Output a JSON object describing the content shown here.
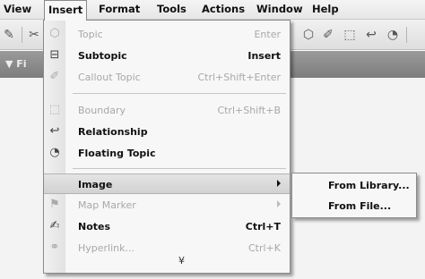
{
  "menubar": {
    "items": [
      "View",
      "Insert",
      "Format",
      "Tools",
      "Actions",
      "Window",
      "Help"
    ]
  },
  "darkbar": {
    "label": "Fi"
  },
  "insert_menu": {
    "items": [
      {
        "label": "Topic",
        "shortcut": "Enter",
        "enabled": false,
        "icon": "topic-icon"
      },
      {
        "label": "Subtopic",
        "shortcut": "Insert",
        "enabled": true,
        "icon": "subtopic-icon"
      },
      {
        "label": "Callout Topic",
        "shortcut": "Ctrl+Shift+Enter",
        "enabled": false,
        "icon": "callout-topic-icon"
      },
      {
        "label": "Boundary",
        "shortcut": "Ctrl+Shift+B",
        "enabled": false,
        "icon": "boundary-icon"
      },
      {
        "label": "Relationship",
        "shortcut": "",
        "enabled": true,
        "icon": "relationship-icon"
      },
      {
        "label": "Floating Topic",
        "shortcut": "",
        "enabled": true,
        "icon": "floating-topic-icon"
      },
      {
        "label": "Image",
        "shortcut": "",
        "enabled": true,
        "icon": "",
        "submenu": true,
        "highlighted": true
      },
      {
        "label": "Map Marker",
        "shortcut": "",
        "enabled": false,
        "icon": "map-marker-icon",
        "submenu": true
      },
      {
        "label": "Notes",
        "shortcut": "Ctrl+T",
        "enabled": true,
        "icon": "notes-icon"
      },
      {
        "label": "Hyperlink...",
        "shortcut": "Ctrl+K",
        "enabled": false,
        "icon": "hyperlink-icon"
      }
    ],
    "more_glyph": "¥"
  },
  "image_submenu": {
    "items": [
      "From Library...",
      "From File..."
    ]
  }
}
